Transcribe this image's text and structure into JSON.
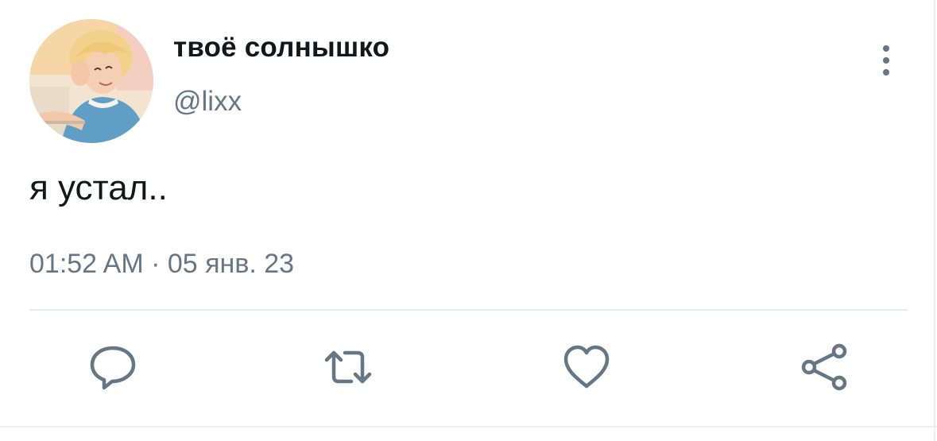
{
  "tweet": {
    "author": {
      "display_name": "твоё солнышко",
      "handle": "@lixx",
      "avatar_icon": "avatar-photo"
    },
    "text": "я устал..",
    "timestamp": "01:52 AM · 05 янв. 23"
  },
  "actions": [
    {
      "icon": "reply-icon"
    },
    {
      "icon": "retweet-icon"
    },
    {
      "icon": "like-icon"
    },
    {
      "icon": "share-icon"
    }
  ],
  "colors": {
    "text_primary": "#14171a",
    "text_secondary": "#657786",
    "icon": "#657786",
    "divider": "#e6ecf0"
  }
}
